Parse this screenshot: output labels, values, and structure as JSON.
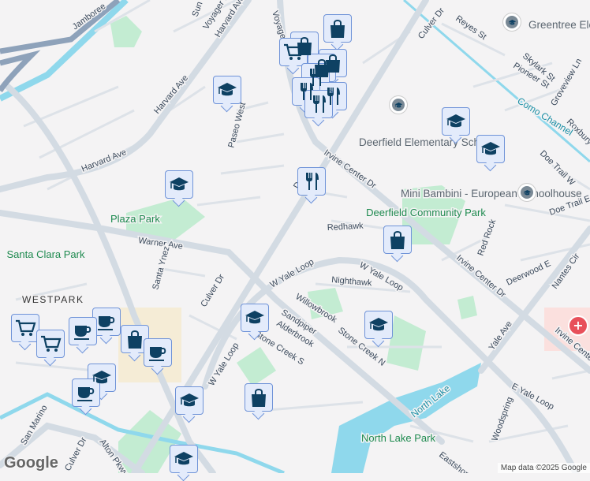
{
  "map": {
    "roads": [
      "Jamboree",
      "Harvard Ave",
      "Harvard Ave",
      "Harvard Ave",
      "Paseo West",
      "Irvine Center Dr",
      "Irvine Center Dr",
      "Irvine Center Dr",
      "Irvine Center Dr",
      "Culver Dr",
      "Culver Dr",
      "Culver Dr",
      "Culver Dr",
      "Warner Ave",
      "Santa Ynez",
      "W Yale Loop",
      "W Yale Loop",
      "W Yale Loop",
      "E Yale Loop",
      "Yale Ave",
      "Redhawk",
      "Nighthawk",
      "Willowbrook",
      "Sandpiper",
      "Alderbrook",
      "Stone Creek S",
      "Stone Creek N",
      "Alton Pkwy",
      "San Marino",
      "Reyes St",
      "Skylark St",
      "Pioneer St",
      "Groveview Ln",
      "Roxbury",
      "Doe Trail W",
      "Doe Trail E",
      "Red Rock",
      "Deerwood E",
      "Nantes Cir",
      "Woodspring",
      "Eastshore",
      "Sun D",
      "Voyager Dr",
      "Irvine C",
      "Dr"
    ],
    "parks": [
      "Plaza Park",
      "Santa Clara Park",
      "Deerfield Community Park",
      "North Lake Park"
    ],
    "places": [
      "Greentree Elementary School",
      "Deerfield Elementary School",
      "Mini Bambini - European Schoolhouse"
    ],
    "water": [
      "Como Channel",
      "North Lake"
    ],
    "neighborhood": "WESTPARK",
    "attribution": "Map data ©2025 Google",
    "logo": "Google"
  }
}
